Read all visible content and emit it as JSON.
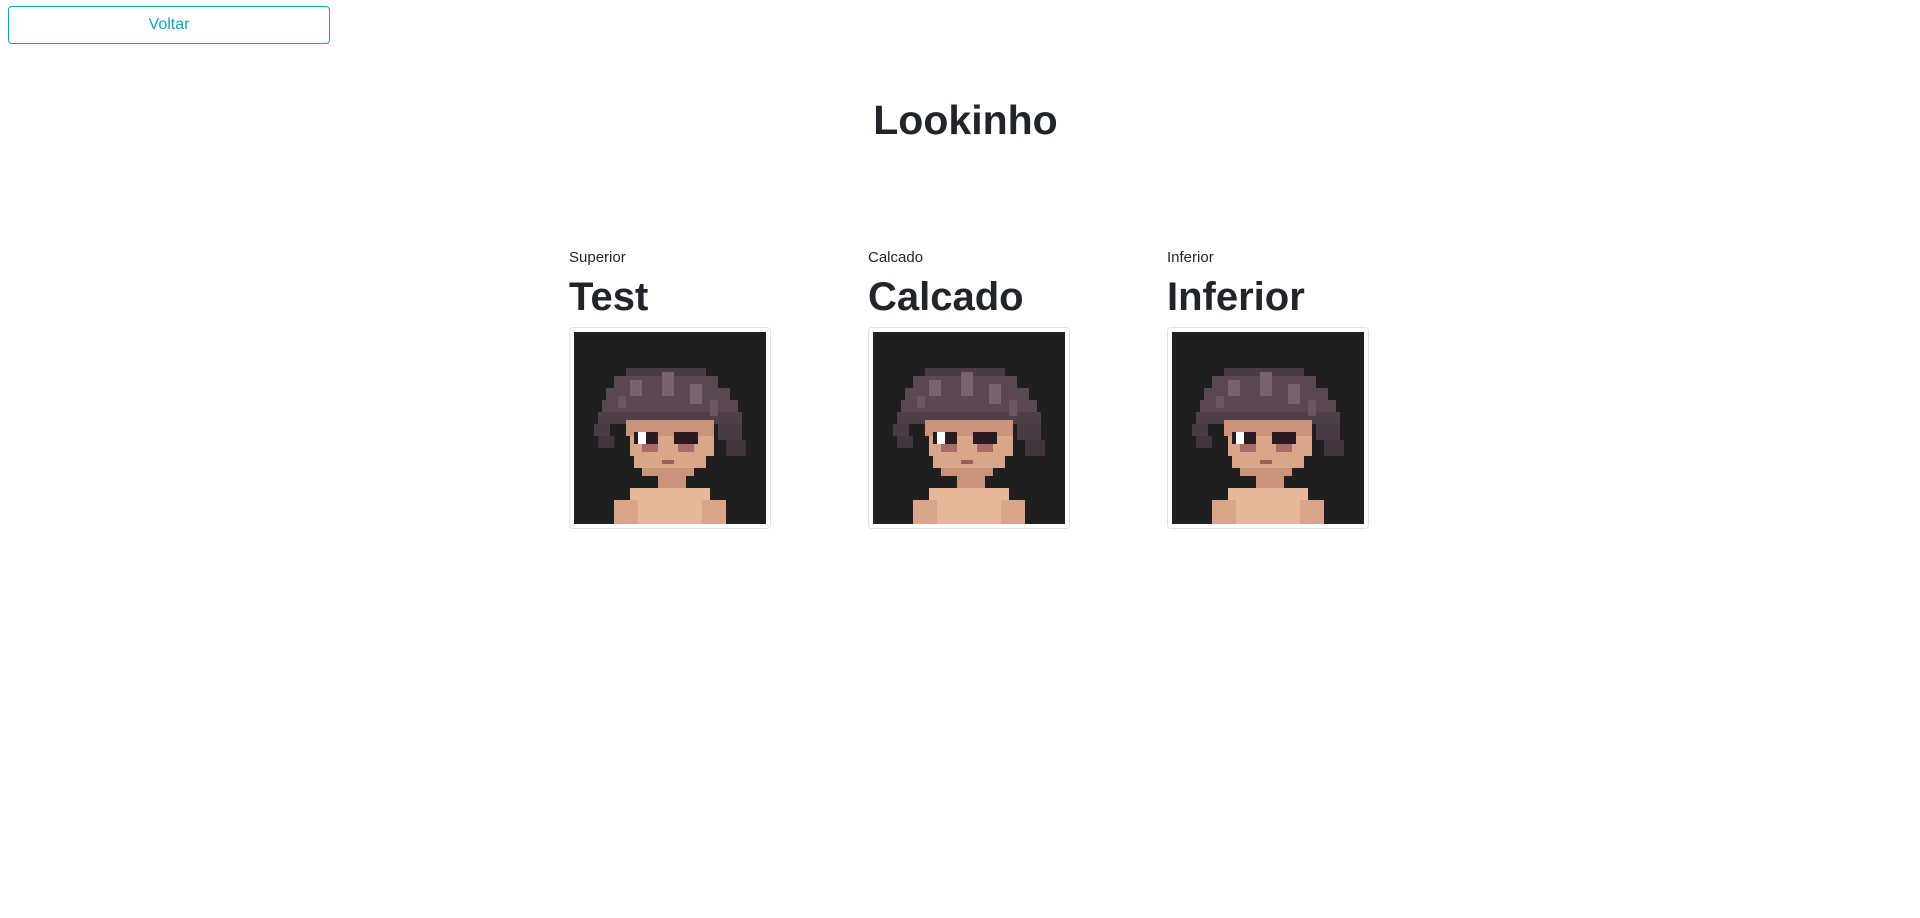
{
  "header": {
    "back_label": "Voltar",
    "title": "Lookinho"
  },
  "cards": [
    {
      "label": "Superior",
      "name": "Test",
      "image_icon": "character-portrait-icon"
    },
    {
      "label": "Calcado",
      "name": "Calcado",
      "image_icon": "character-portrait-icon"
    },
    {
      "label": "Inferior",
      "name": "Inferior",
      "image_icon": "character-portrait-icon"
    }
  ],
  "colors": {
    "accent": "#17a2b8",
    "text": "#212529",
    "portrait_background": "#1f1f1f",
    "hair": "#5a4854",
    "skin": "#d9a689"
  }
}
